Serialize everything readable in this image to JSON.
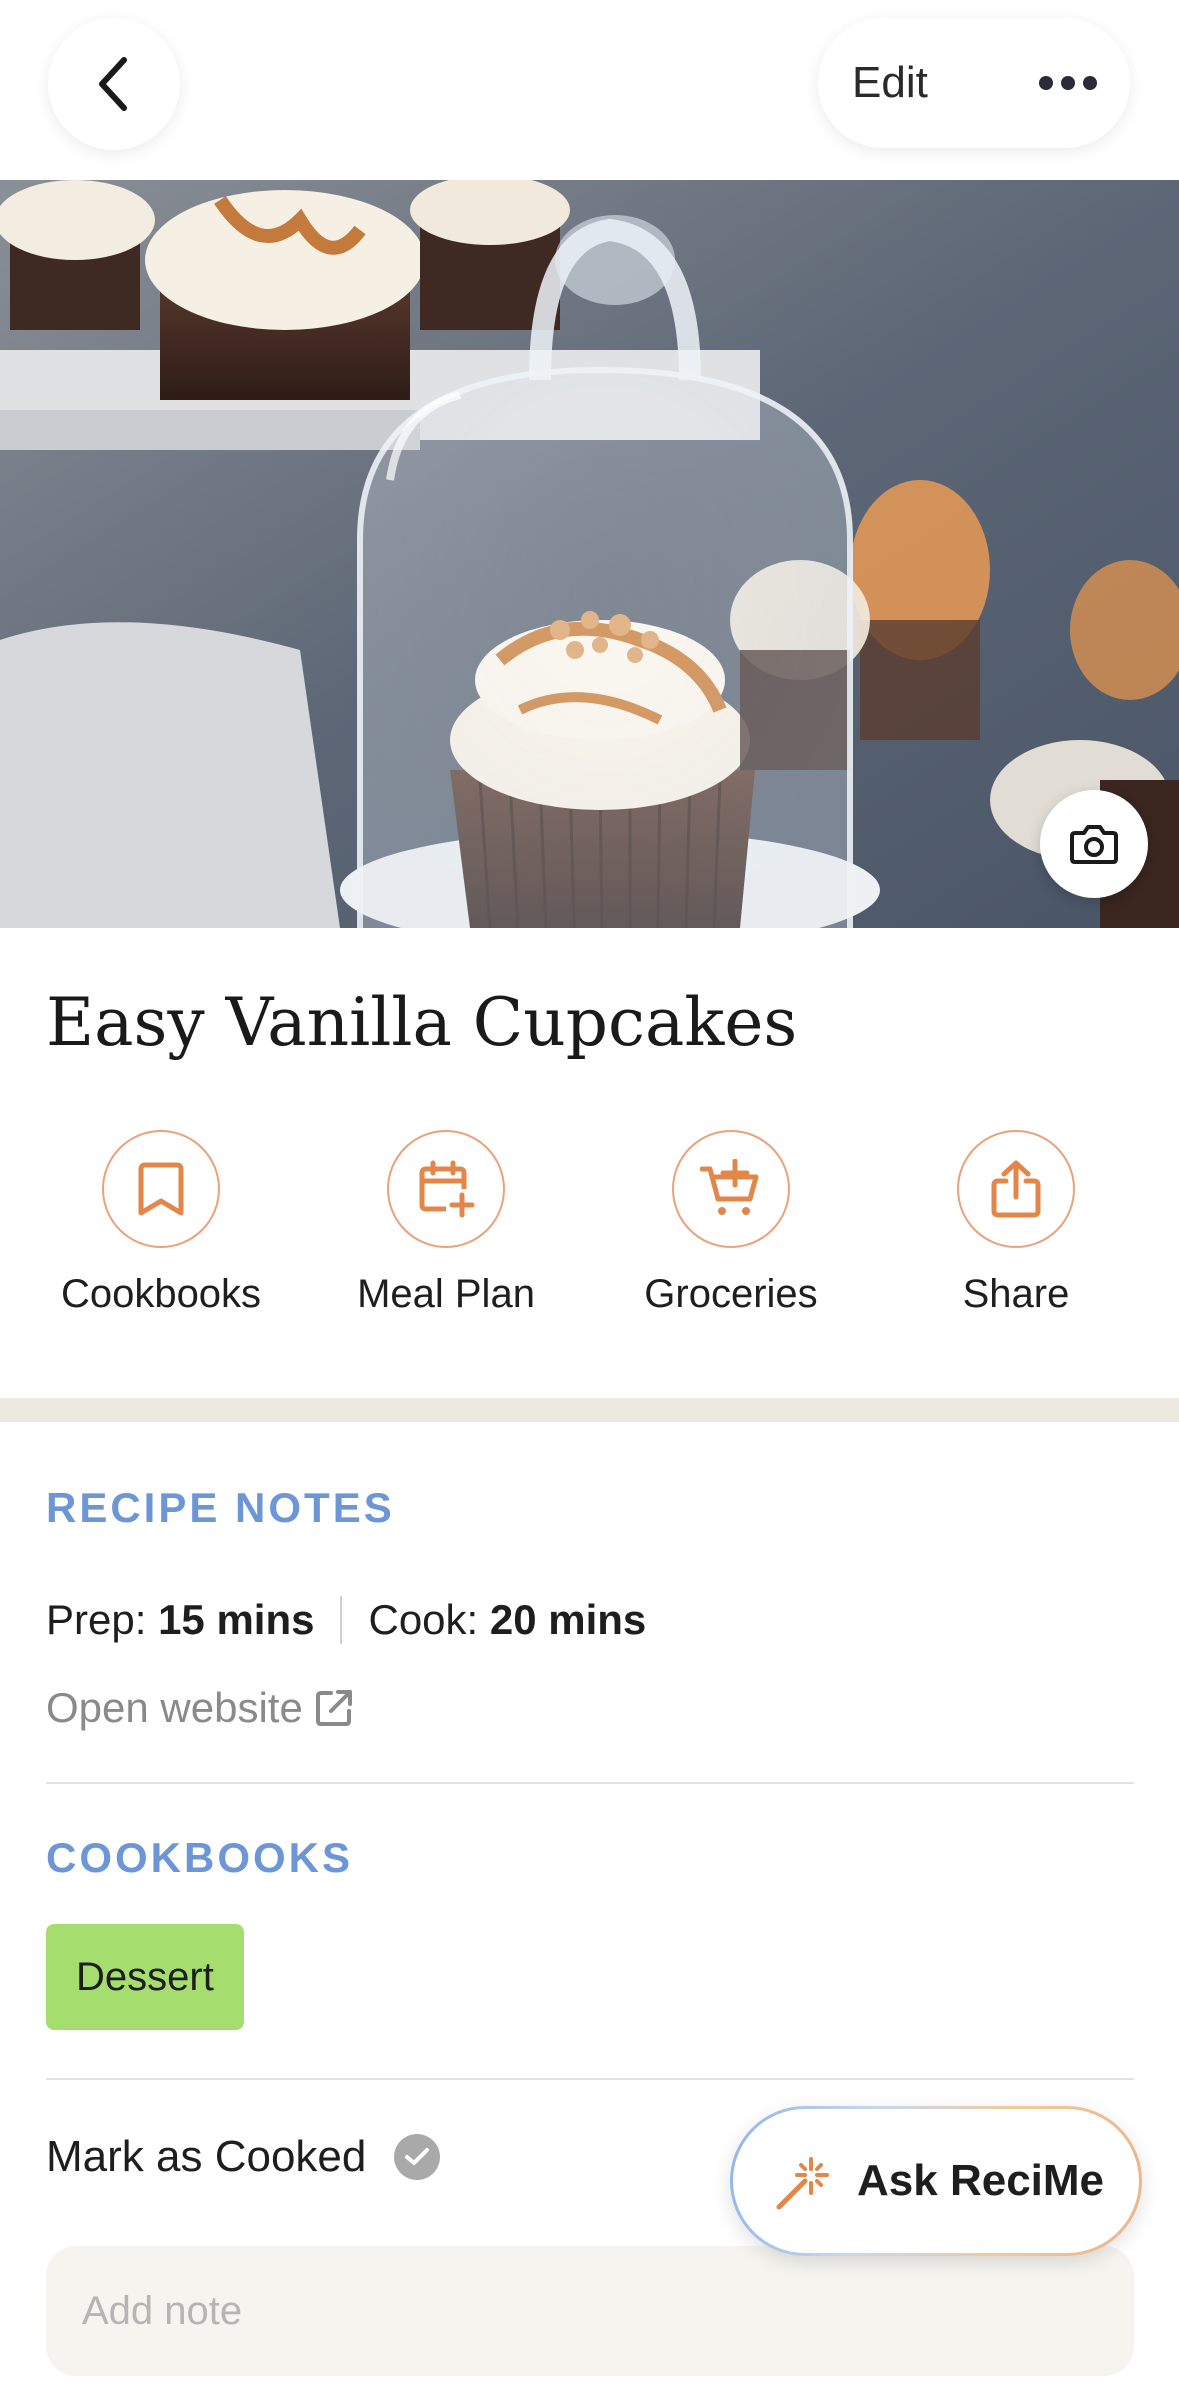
{
  "header": {
    "back_icon": "chevron-left-icon",
    "edit_label": "Edit",
    "more_icon": "ellipsis-icon"
  },
  "hero": {
    "photo_icon": "camera-icon"
  },
  "recipe": {
    "title": "Easy Vanilla Cupcakes"
  },
  "actions": [
    {
      "label": "Cookbooks",
      "icon": "bookmark-icon"
    },
    {
      "label": "Meal Plan",
      "icon": "calendar-plus-icon"
    },
    {
      "label": "Groceries",
      "icon": "cart-plus-icon"
    },
    {
      "label": "Share",
      "icon": "share-icon"
    }
  ],
  "notes": {
    "heading": "RECIPE NOTES",
    "prep_label": "Prep:",
    "prep_value": "15 mins",
    "cook_label": "Cook:",
    "cook_value": "20 mins",
    "open_website": "Open website"
  },
  "cookbooks": {
    "heading": "COOKBOOKS",
    "tags": [
      "Dessert"
    ]
  },
  "cooked": {
    "label": "Mark as Cooked"
  },
  "note_input": {
    "placeholder": "Add note"
  },
  "assistant": {
    "label": "Ask ReciMe",
    "icon": "magic-wand-icon"
  },
  "colors": {
    "accent": "#e3864a",
    "section_heading": "#6d96d6",
    "tag_bg": "#a6dd6f"
  }
}
